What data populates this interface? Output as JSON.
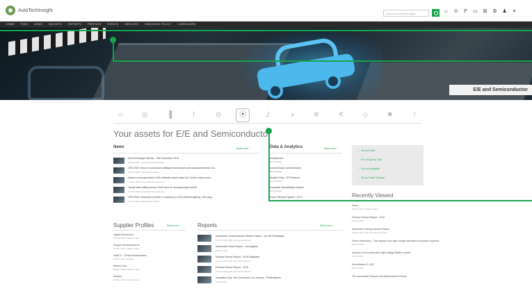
{
  "brand": {
    "name": "AutoTechInsight"
  },
  "search": {
    "placeholder": "Search AutoTechInsight"
  },
  "top_icons": [
    "bell-icon",
    "help-icon",
    "ppt-icon",
    "monitor-icon",
    "grid-icon",
    "gear-icon",
    "user-icon",
    "menu-icon"
  ],
  "nav": [
    "HOME",
    "FEED",
    "NEWS",
    "INSIGHTS",
    "REPORTS",
    "PROFILES",
    "EVENTS",
    "SERVICES",
    "EMISSIONS POLICY",
    "LEARN MORE"
  ],
  "hero": {
    "label": "E/E and Semiconductor"
  },
  "domain_icons": [
    {
      "name": "powertrain-icon",
      "glyph": "▱",
      "active": false
    },
    {
      "name": "wheel-icon",
      "glyph": "◎",
      "active": false
    },
    {
      "name": "battery-icon",
      "glyph": "▐",
      "active": false
    },
    {
      "name": "charging-icon",
      "glyph": "⌇",
      "active": false
    },
    {
      "name": "steering-icon",
      "glyph": "⊝",
      "active": false
    },
    {
      "name": "semiconductor-icon",
      "glyph": "⦿",
      "active": true
    },
    {
      "name": "telematics-icon",
      "glyph": "⅃",
      "active": false
    },
    {
      "name": "sensor-icon",
      "glyph": "◑",
      "active": false
    },
    {
      "name": "autonomy-icon",
      "glyph": "✲",
      "active": false
    },
    {
      "name": "lighting-icon",
      "glyph": "∢",
      "active": false
    },
    {
      "name": "connected-icon",
      "glyph": "◇",
      "active": false
    },
    {
      "name": "settings-icon",
      "glyph": "✸",
      "active": false
    },
    {
      "name": "tools-icon",
      "glyph": "⫯",
      "active": false
    }
  ],
  "assets_title": "Your assets for E/E and Semiconductor",
  "news": {
    "heading": "News",
    "read_more": "Read more ›",
    "items": [
      {
        "title": "AutoTechInsight Weekly - 19th December 2019",
        "meta": "19 Dec 2019 | AutoTechInsight Weekly"
      },
      {
        "title": "CES 2020: Bosch to showcase intelligent front camera and advanced interior mo...",
        "meta": "18 Dec 2019 | Technology Trends"
      },
      {
        "title": "Saleen's next-generation 6.55 millimeter-wave radar SoC enters mass produ...",
        "meta": "17 Dec 2019 | Corporate Developments"
      },
      {
        "title": "Yazaki adds battery sensor HUB flash for next generation ADAS",
        "meta": "17 Dec 2019 | Corporate Developments"
      },
      {
        "title": "CES 2020: Ambarella exhibits IC solutions for LED ambient lighting, LED wing ..",
        "meta": "17 Dec 2019 | Technology Trends"
      }
    ]
  },
  "data_analytics": {
    "heading": "Data & Analytics",
    "read_more": "Read more ›",
    "items": [
      {
        "title": "Infotainment",
        "meta": "EPS MODEL"
      },
      {
        "title": "Central Body Control Module",
        "meta": "EPS MODEL"
      },
      {
        "title": "Update Entry - RF Receiver",
        "meta": "EPS MODEL"
      },
      {
        "title": "Occupant Classification System",
        "meta": "EPS MODEL"
      },
      {
        "title": "Power Window System - ECU",
        "meta": "EPS MODEL"
      }
    ]
  },
  "goto": [
    "Go to Feed",
    "Go to Query Tool",
    "Go to Analytics",
    "Go to Feed Tracker"
  ],
  "recently_viewed": {
    "heading": "Recently Viewed",
    "items": [
      {
        "title": "Sumo",
        "meta": "18 Dec 2019 | Hidden Cities"
      },
      {
        "title": "Exhaust Sensor Report - 2018",
        "meta": "18 Dec 2019"
      },
      {
        "title": "Automotive Wiring Harness Report",
        "meta": "18 Dec 2019 | E/E and Semiconductor"
      },
      {
        "title": "Power electronics - The impacts from high voltage alternative propulsion systems",
        "meta": "04 Nov 2019"
      },
      {
        "title": "Analysis of the automotive high voltage Battery market",
        "meta": "02 Jul 2019"
      },
      {
        "title": "Electrification 5, 48V",
        "meta": "05 Feb 2019"
      },
      {
        "title": "The automotive Exhaust and aftertreatment Report",
        "meta": ""
      }
    ]
  },
  "supplier_profiles": {
    "heading": "Supplier Profiles",
    "read_more": "Read more ›",
    "items": [
      {
        "title": "Jaybird Electronics",
        "meta": "18 Dec 2019 | Hidden Cities"
      },
      {
        "title": "Kongsh Electrosolutions",
        "meta": "09 Dec 2019 | Hidden Cities"
      },
      {
        "title": "NABCO - Global Headquarters",
        "meta": "09 Dec 2019 | Europe"
      },
      {
        "title": "Nelsen Corp",
        "meta": "09 Dec 2019 | Hidden Cities"
      },
      {
        "title": "Audaint",
        "meta": "09 Dec 2019 | Japan/Korea"
      }
    ]
  },
  "reports": {
    "heading": "Reports",
    "read_more": "Read more ›",
    "items": [
      {
        "title": "Automotive Semiconductor Market Tracker - Q4 2019 Database",
        "meta": "18 Dec 2019 | E/E and Semiconductor"
      },
      {
        "title": "Automotive Show Report - Los Angeles",
        "meta": "18 Nov 2019"
      },
      {
        "title": "Exhaust Sensor Report - 2019 Database",
        "meta": "14 Nov 2019 | E/E and Semiconductor"
      },
      {
        "title": "Exhaust Sensor Report - 2019",
        "meta": "14 Nov 2019 | E/E and Semiconductor"
      },
      {
        "title": "Innovation Day: The Connected Car Journey - Presentations",
        "meta": "30 Oct 2019"
      }
    ]
  },
  "colors": {
    "accent": "#18a44a",
    "nav_bg": "#2a2a2a",
    "hero_glow": "#4cb8ec"
  }
}
